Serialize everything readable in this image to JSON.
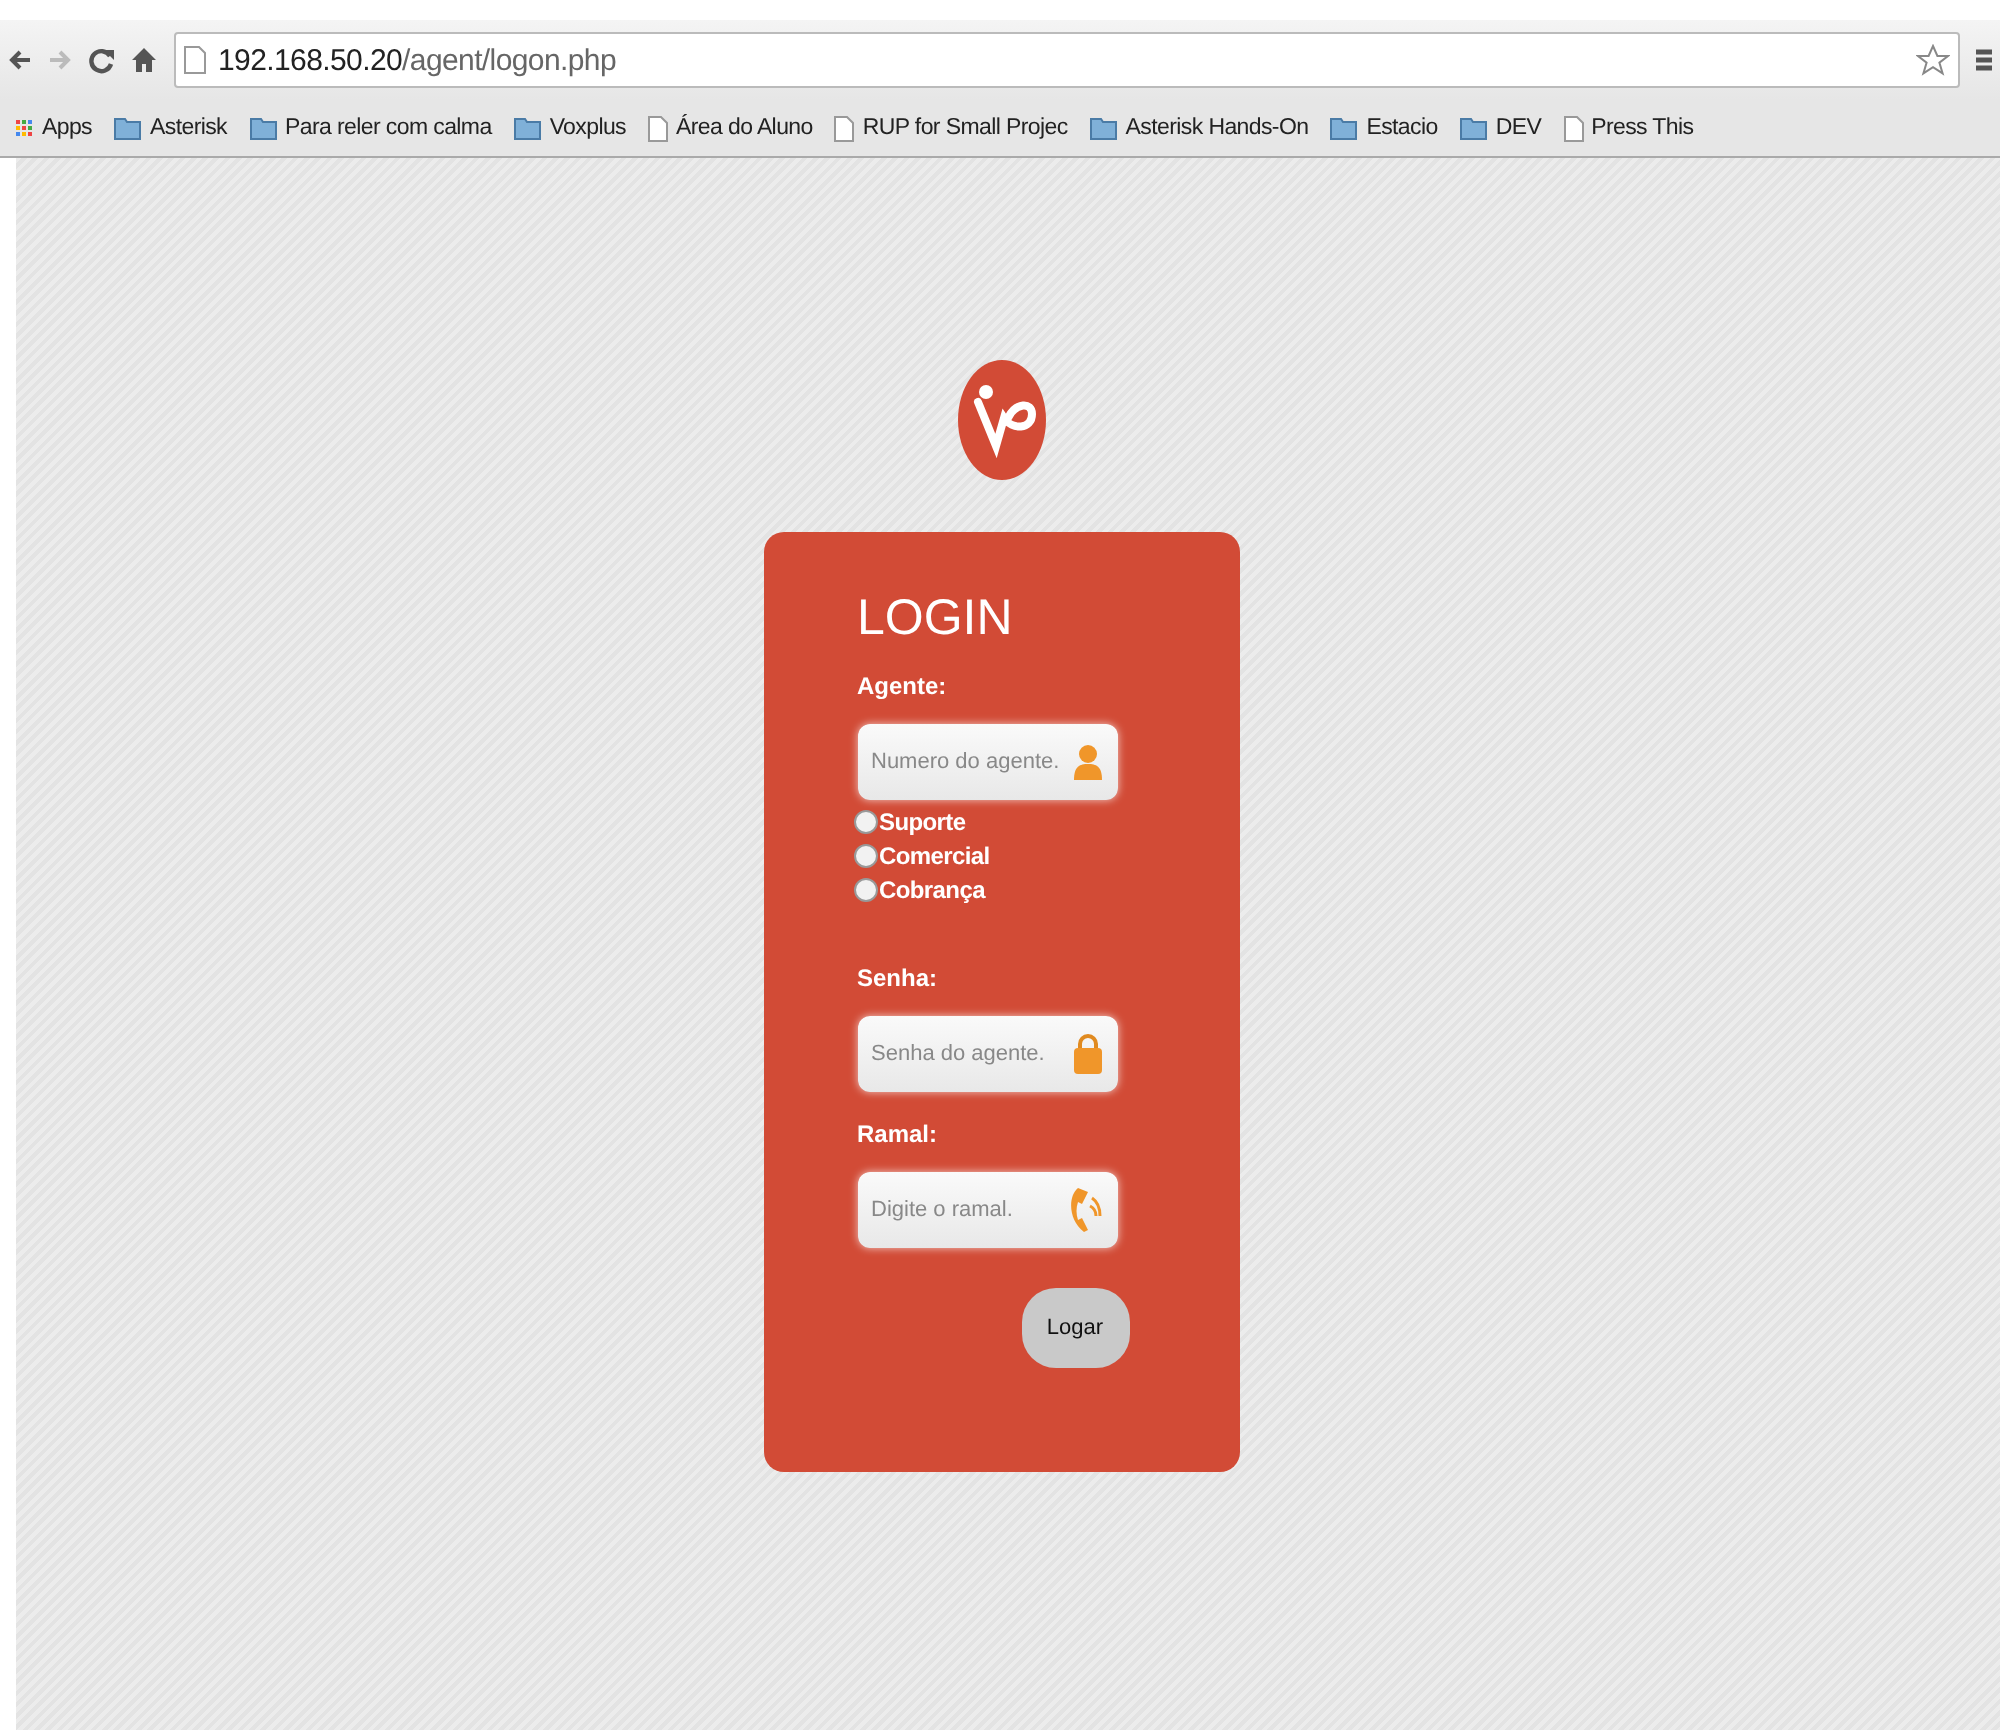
{
  "browser": {
    "address": {
      "host": "192.168.50.20",
      "path": "/agent/logon.php"
    },
    "bookmarks": [
      {
        "label": "Apps",
        "kind": "apps"
      },
      {
        "label": "Asterisk",
        "kind": "folder"
      },
      {
        "label": "Para reler com calma",
        "kind": "folder"
      },
      {
        "label": "Voxplus",
        "kind": "folder"
      },
      {
        "label": "Área do Aluno",
        "kind": "page"
      },
      {
        "label": "RUP for Small Projec",
        "kind": "page"
      },
      {
        "label": "Asterisk Hands-On",
        "kind": "folder"
      },
      {
        "label": "Estacio",
        "kind": "folder"
      },
      {
        "label": "DEV",
        "kind": "folder"
      },
      {
        "label": "Press This",
        "kind": "page"
      }
    ]
  },
  "login": {
    "title": "LOGIN",
    "agent": {
      "label": "Agente:",
      "placeholder": "Numero do agente."
    },
    "queues": [
      {
        "label": "Suporte",
        "selected": false
      },
      {
        "label": "Comercial",
        "selected": false
      },
      {
        "label": "Cobrança",
        "selected": false
      }
    ],
    "password": {
      "label": "Senha:",
      "placeholder": "Senha do agente."
    },
    "extension": {
      "label": "Ramal:",
      "placeholder": "Digite o ramal."
    },
    "submit": "Logar"
  }
}
